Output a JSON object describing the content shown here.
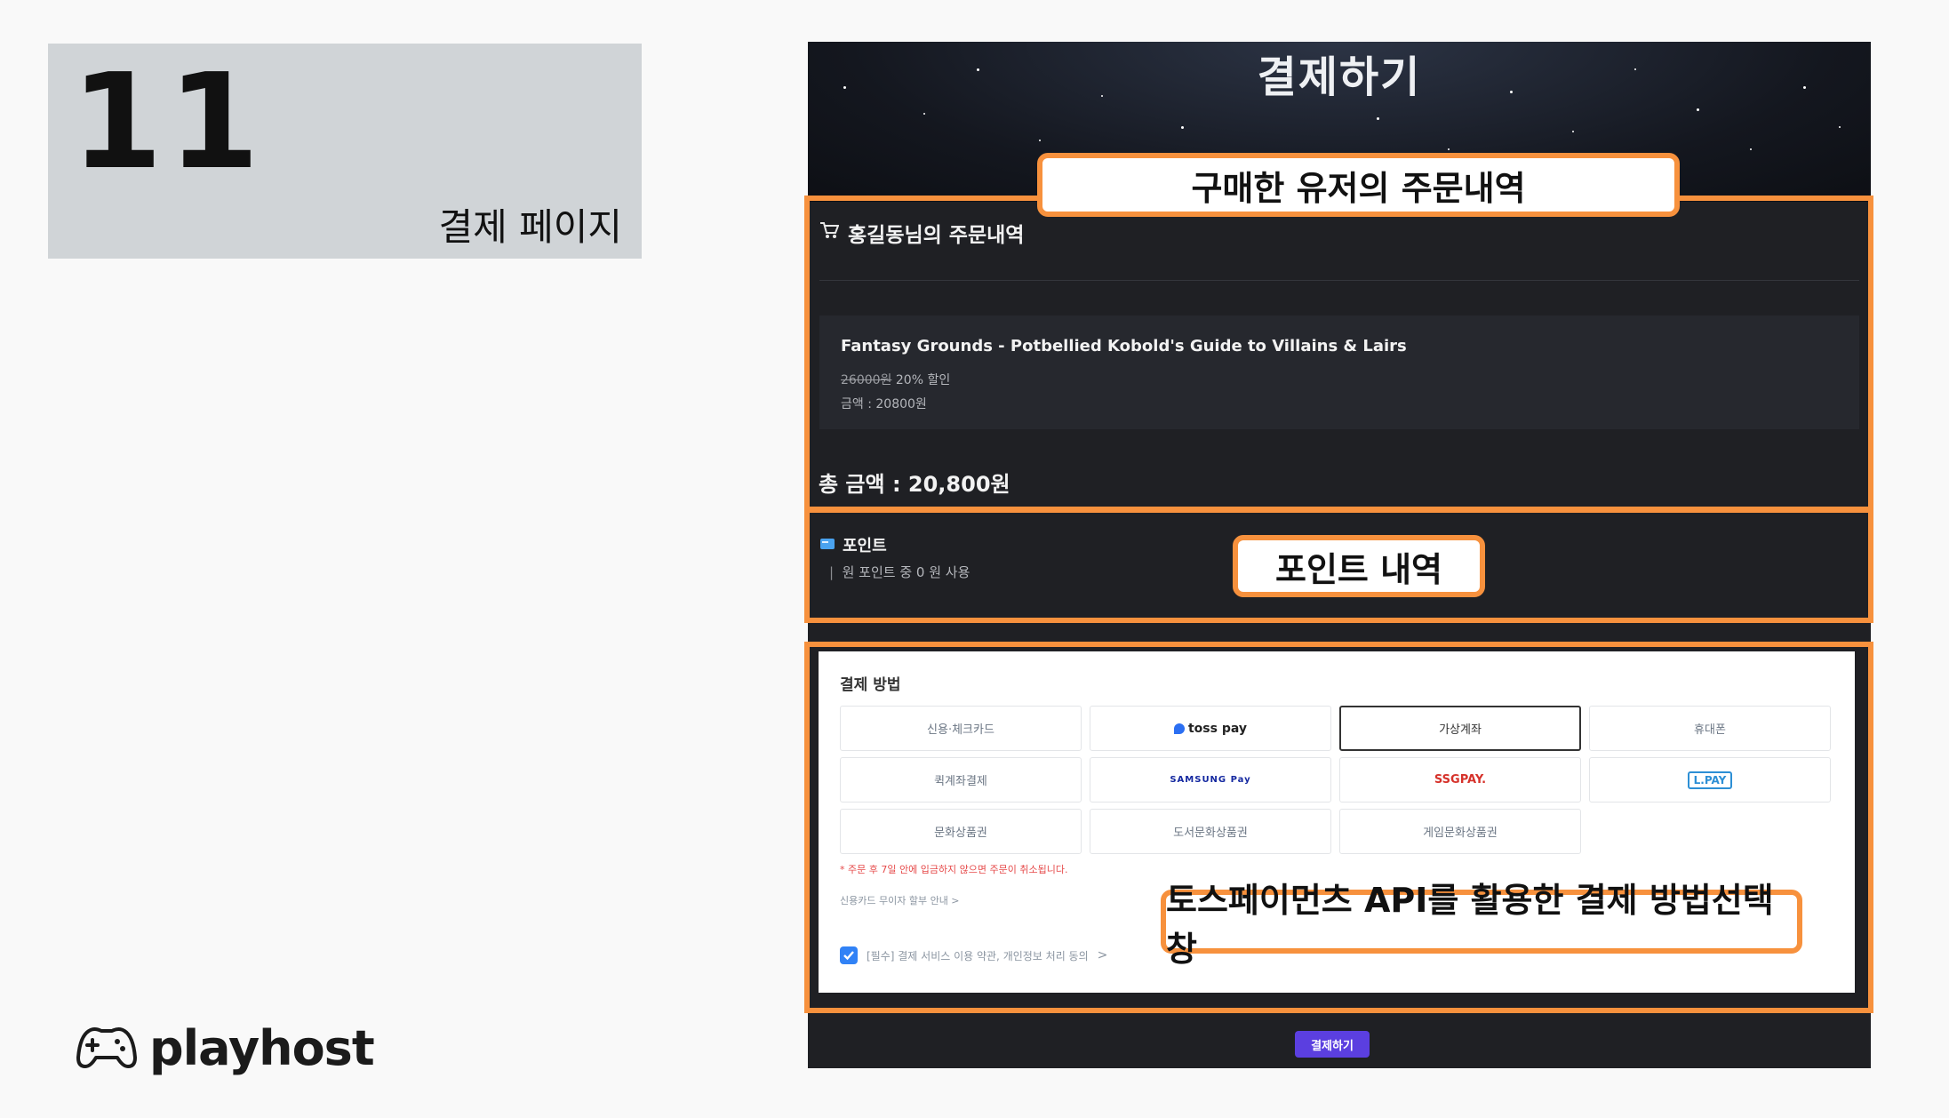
{
  "slide": {
    "number": "11",
    "title": "결제 페이지"
  },
  "logo": {
    "text": "playhost",
    "icon": "gamepad-icon"
  },
  "page": {
    "title": "결제하기",
    "order": {
      "title": "홍길동님의 주문내역",
      "icon": "cart-icon",
      "items": [
        {
          "name": "Fantasy Grounds - Potbellied Kobold's Guide to Villains & Lairs",
          "original_price": "26000원",
          "discount": "20% 할인",
          "amount": "금액 : 20800원"
        }
      ],
      "total": "총 금액 : 20,800원"
    },
    "point": {
      "title": "포인트",
      "icon": "point-card-icon",
      "desc": "원 포인트 중 0 원 사용"
    },
    "payment": {
      "title": "결제 방법",
      "methods": [
        {
          "label": "신용·체크카드",
          "selected": false
        },
        {
          "label": "toss pay",
          "selected": false
        },
        {
          "label": "가상계좌",
          "selected": true
        },
        {
          "label": "휴대폰",
          "selected": false
        },
        {
          "label": "퀵계좌결제",
          "selected": false
        },
        {
          "label": "SAMSUNG Pay",
          "selected": false
        },
        {
          "label": "SSGPAY.",
          "selected": false
        },
        {
          "label": "L.PAY",
          "selected": false
        },
        {
          "label": "문화상품권",
          "selected": false
        },
        {
          "label": "도서문화상품권",
          "selected": false
        },
        {
          "label": "게임문화상품권",
          "selected": false
        }
      ],
      "notice": "* 주문 후 7일 안에 입금하지 않으면 주문이 취소됩니다.",
      "card_info": "신용카드 무이자 할부 안내 >",
      "agree": "[필수] 결제 서비스 이용 약관, 개인정보 처리 동의",
      "agree_checked": true
    },
    "pay_button": "결제하기"
  },
  "annotations": {
    "order": "구매한 유저의 주문내역",
    "point": "포인트 내역",
    "payment": "토스페이먼츠 API를 활용한 결제 방법선택창"
  },
  "colors": {
    "annotation": "#f7913d",
    "pay_button": "#5b3fe0",
    "checkbox": "#3182f6"
  }
}
